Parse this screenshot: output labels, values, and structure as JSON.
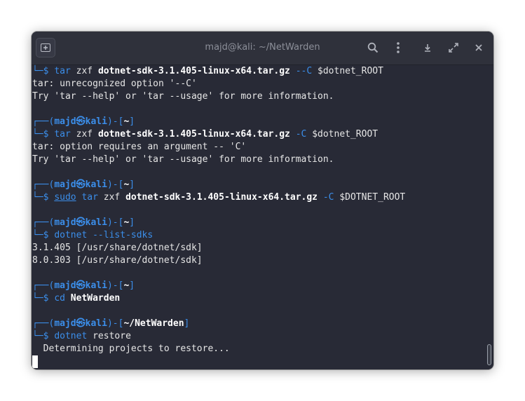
{
  "window": {
    "title": "majd@kali: ~/NetWarden"
  },
  "toolbar": {
    "new_tab_icon": "new-tab-icon",
    "search_icon": "search-icon",
    "menu_icon": "kebab-menu-icon",
    "minimize_icon": "minimize-icon",
    "maximize_icon": "maximize-icon",
    "close_icon": "close-icon"
  },
  "colors": {
    "background": "#282a36",
    "titlebar": "#2f313b",
    "prompt_blue": "#3b8eea",
    "text": "#e6e6e6"
  },
  "terminal": {
    "l1": {
      "corner": "└─",
      "dollar": "$ ",
      "cmd": "tar",
      "arg1": " zxf ",
      "file": "dotnet-sdk-3.1.405-linux-x64.tar.gz",
      "opt": " --C ",
      "rest": "$dotnet_ROOT"
    },
    "l2": "tar: unrecognized option '--C'",
    "l3": "Try 'tar --help' or 'tar --usage' for more information.",
    "p2": {
      "open": "┌──(",
      "user": "majd",
      "at": "㉿",
      "host": "kali",
      "close": ")-[",
      "dir": "~",
      "end": "]"
    },
    "l5": {
      "corner": "└─",
      "dollar": "$ ",
      "cmd": "tar",
      "arg1": " zxf ",
      "file": "dotnet-sdk-3.1.405-linux-x64.tar.gz",
      "opt": " -C ",
      "rest": "$dotnet_ROOT"
    },
    "l6": "tar: option requires an argument -- 'C'",
    "l7": "Try 'tar --help' or 'tar --usage' for more information.",
    "p3": {
      "open": "┌──(",
      "user": "majd",
      "at": "㉿",
      "host": "kali",
      "close": ")-[",
      "dir": "~",
      "end": "]"
    },
    "l9": {
      "corner": "└─",
      "dollar": "$ ",
      "sudo": "sudo",
      "sp": " ",
      "cmd": "tar",
      "arg1": " zxf ",
      "file": "dotnet-sdk-3.1.405-linux-x64.tar.gz",
      "opt": " -C ",
      "rest": "$DOTNET_ROOT"
    },
    "p4": {
      "open": "┌──(",
      "user": "majd",
      "at": "㉿",
      "host": "kali",
      "close": ")-[",
      "dir": "~",
      "end": "]"
    },
    "l11": {
      "corner": "└─",
      "dollar": "$ ",
      "cmd": "dotnet",
      "opt": " --list-sdks"
    },
    "l12": "3.1.405 [/usr/share/dotnet/sdk]",
    "l13": "8.0.303 [/usr/share/dotnet/sdk]",
    "p5": {
      "open": "┌──(",
      "user": "majd",
      "at": "㉿",
      "host": "kali",
      "close": ")-[",
      "dir": "~",
      "end": "]"
    },
    "l15": {
      "corner": "└─",
      "dollar": "$ ",
      "cmd": "cd",
      "sp": " ",
      "arg": "NetWarden"
    },
    "p6": {
      "open": "┌──(",
      "user": "majd",
      "at": "㉿",
      "host": "kali",
      "close": ")-[",
      "dir": "~/NetWarden",
      "end": "]"
    },
    "l17": {
      "corner": "└─",
      "dollar": "$ ",
      "cmd": "dotnet",
      "arg": " restore"
    },
    "l18": "  Determining projects to restore..."
  }
}
